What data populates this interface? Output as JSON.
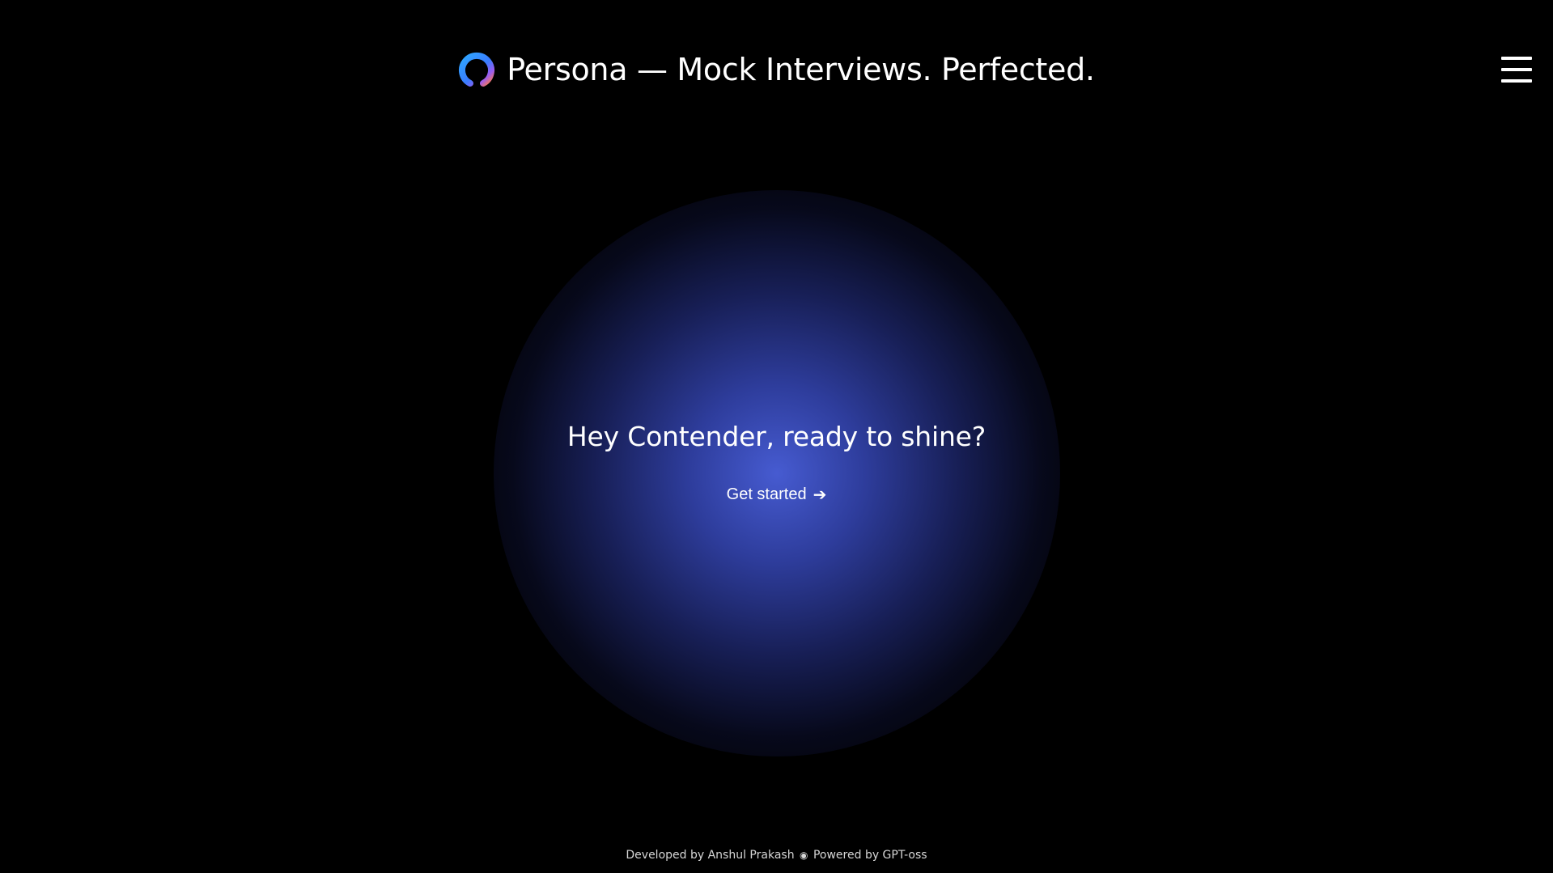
{
  "header": {
    "title": "Persona — Mock Interviews. Perfected.",
    "logo_icon": "ring-logo-icon",
    "menu_icon": "hamburger-menu-icon"
  },
  "hero": {
    "greeting": "Hey Contender, ready to shine?",
    "cta_label": "Get started",
    "cta_arrow": "➔"
  },
  "footer": {
    "developer_text": "Developed by Anshul Prakash",
    "separator": "◉",
    "powered_text": "Powered by GPT-oss"
  },
  "colors": {
    "background": "#000000",
    "glow": "#4a60dc",
    "logo_gradient_start": "#2ea8ff",
    "logo_gradient_end": "#ff7a45",
    "text": "#ffffff"
  }
}
